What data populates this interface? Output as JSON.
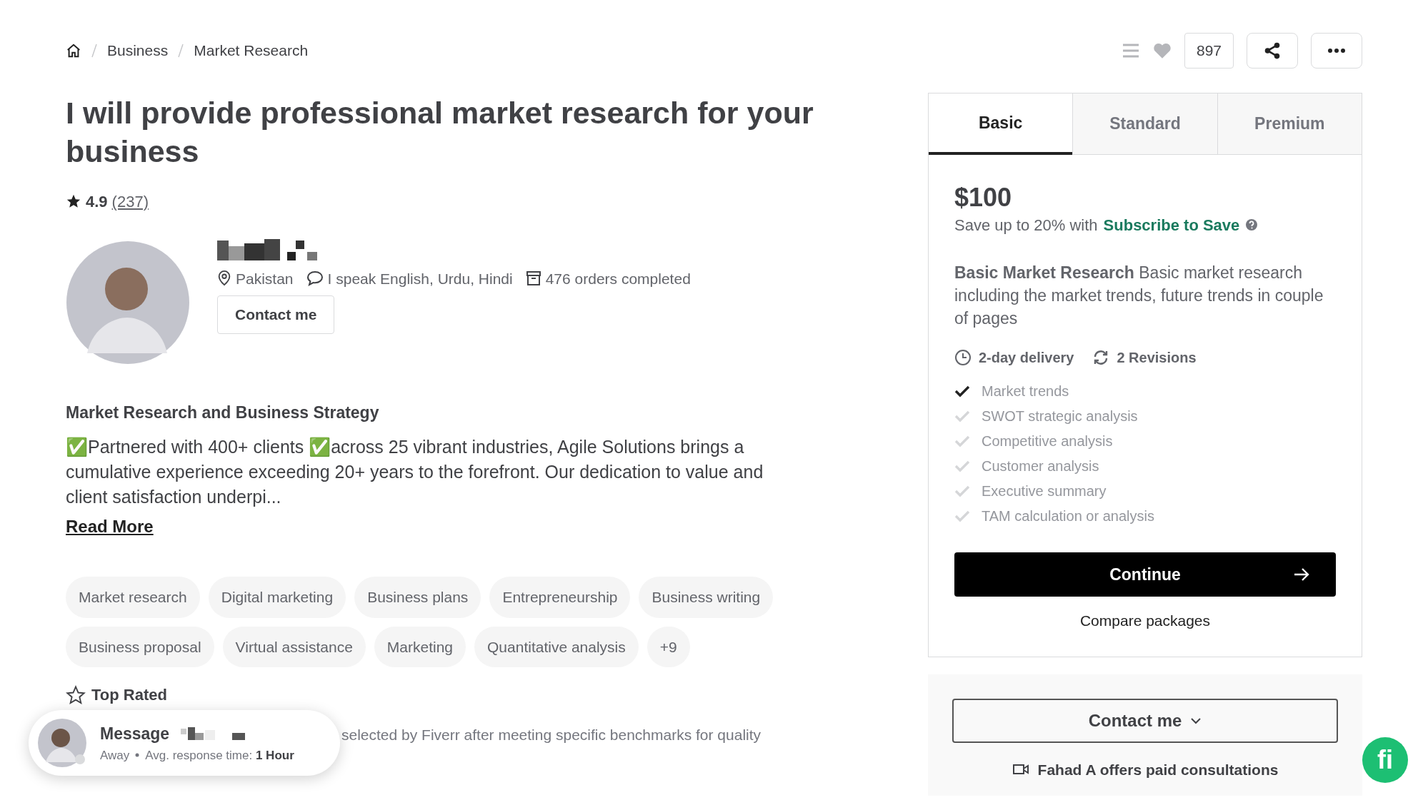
{
  "breadcrumb": [
    "Business",
    "Market Research"
  ],
  "actions": {
    "likes": "897"
  },
  "title": "I will provide professional market research for your business",
  "rating": {
    "score": "4.9",
    "count": "(237)"
  },
  "seller": {
    "location": "Pakistan",
    "languages": "I speak English, Urdu, Hindi",
    "orders": "476 orders completed",
    "contact": "Contact me"
  },
  "about": {
    "heading": "Market Research and Business Strategy",
    "text": "✅Partnered with 400+ clients ✅across 25 vibrant industries, Agile Solutions brings a cumulative experience exceeding 20+ years to the forefront. Our dedication to value and client satisfaction underpi...",
    "read_more": "Read More"
  },
  "tags": [
    "Market research",
    "Digital marketing",
    "Business plans",
    "Entrepreneurship",
    "Business writing",
    "Business proposal",
    "Virtual assistance",
    "Marketing",
    "Quantitative analysis",
    "+9"
  ],
  "top_rated": {
    "label": "Top Rated",
    "text": "selected by Fiverr after meeting specific benchmarks for quality"
  },
  "message_popup": {
    "title": "Message",
    "status": "Away",
    "response": "Avg. response time: **1 Hour**"
  },
  "packages": {
    "tabs": [
      {
        "label": "Basic",
        "selected": true
      },
      {
        "label": "Standard",
        "selected": false
      },
      {
        "label": "Premium",
        "selected": false
      }
    ],
    "price": "$100",
    "save_text": "Save up to 20% with",
    "save_link": "Subscribe to Save",
    "description": "**Basic Market Research** Basic market research including the market trends, future trends in couple of pages",
    "delivery": "2-day delivery",
    "revisions": "2 Revisions",
    "features": [
      {
        "label": "Market trends",
        "included": true
      },
      {
        "label": "SWOT strategic analysis",
        "included": false
      },
      {
        "label": "Competitive analysis",
        "included": false
      },
      {
        "label": "Customer analysis",
        "included": false
      },
      {
        "label": "Executive summary",
        "included": false
      },
      {
        "label": "TAM calculation or analysis",
        "included": false
      }
    ],
    "continue": "Continue",
    "compare": "Compare packages"
  },
  "contact_panel": {
    "button": "Contact me",
    "consult": "Fahad A offers paid consultations"
  },
  "chat_button": {
    "label": "fi"
  }
}
